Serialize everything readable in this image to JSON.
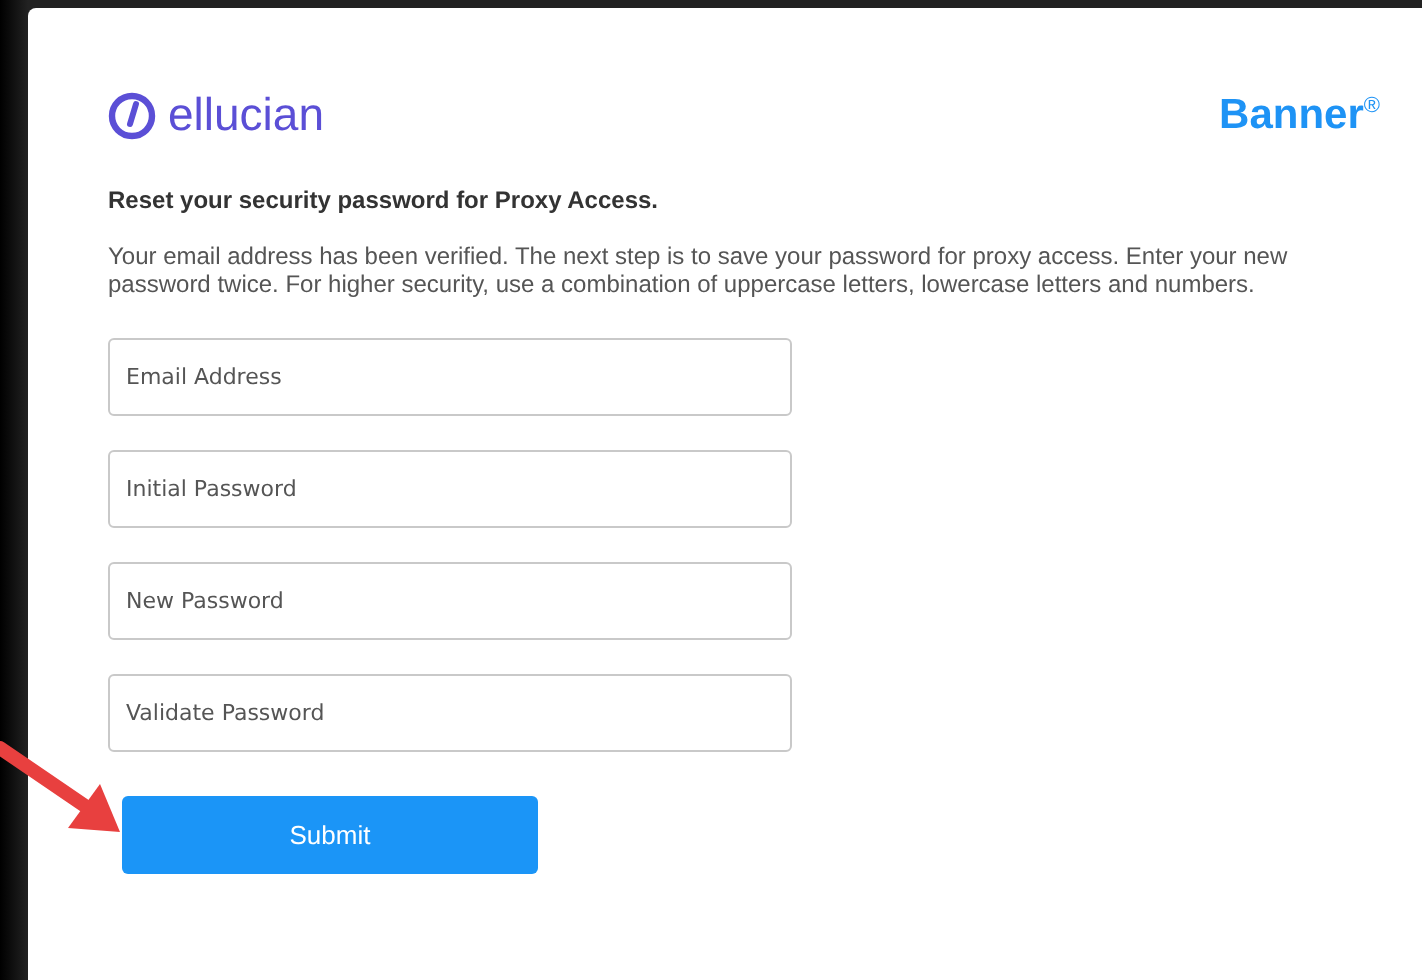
{
  "brand": {
    "logo_text": "ellucian",
    "product": "Banner$^{®}$"
  },
  "heading": "Reset your security password for Proxy Access.",
  "instructions": "Your email address has been verified. The next step is to save your password for proxy access. Enter your new password twice. For higher security, use a combination of uppercase letters, lowercase letters and numbers.",
  "fields": [
    {
      "placeholder": "Email Address"
    },
    {
      "placeholder": "Initial Password"
    },
    {
      "placeholder": "New Password"
    },
    {
      "placeholder": "Validate Password"
    }
  ],
  "buttons": [
    "Submit"
  ]
}
